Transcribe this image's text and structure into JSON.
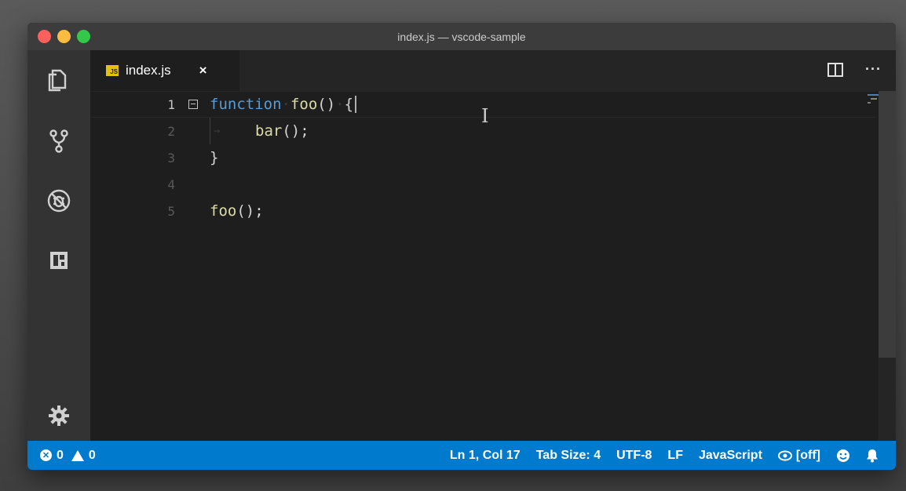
{
  "window": {
    "title": "index.js — vscode-sample"
  },
  "activity_bar": {
    "items": [
      {
        "icon": "files-icon"
      },
      {
        "icon": "source-control-icon"
      },
      {
        "icon": "debug-icon"
      },
      {
        "icon": "extensions-icon"
      }
    ],
    "settings_icon": "gear-icon"
  },
  "tab": {
    "badge": "JS",
    "label": "index.js",
    "close": "×"
  },
  "tab_actions": {
    "split": "split-editor-icon",
    "more": "···"
  },
  "editor": {
    "lines": [
      {
        "num": "1",
        "text": "function foo() {"
      },
      {
        "num": "2",
        "text": "bar();"
      },
      {
        "num": "3",
        "text": "}"
      },
      {
        "num": "4",
        "text": ""
      },
      {
        "num": "5",
        "text": "foo();"
      }
    ]
  },
  "status": {
    "errors": "0",
    "warnings": "0",
    "position": "Ln 1, Col 17",
    "tab_size": "Tab Size: 4",
    "encoding": "UTF-8",
    "eol": "LF",
    "language": "JavaScript",
    "watch": "[off]"
  },
  "colors": {
    "statusbar": "#007acc",
    "keyword": "#569cd6",
    "function": "#dcdcaa",
    "js_badge": "#e5c012"
  }
}
